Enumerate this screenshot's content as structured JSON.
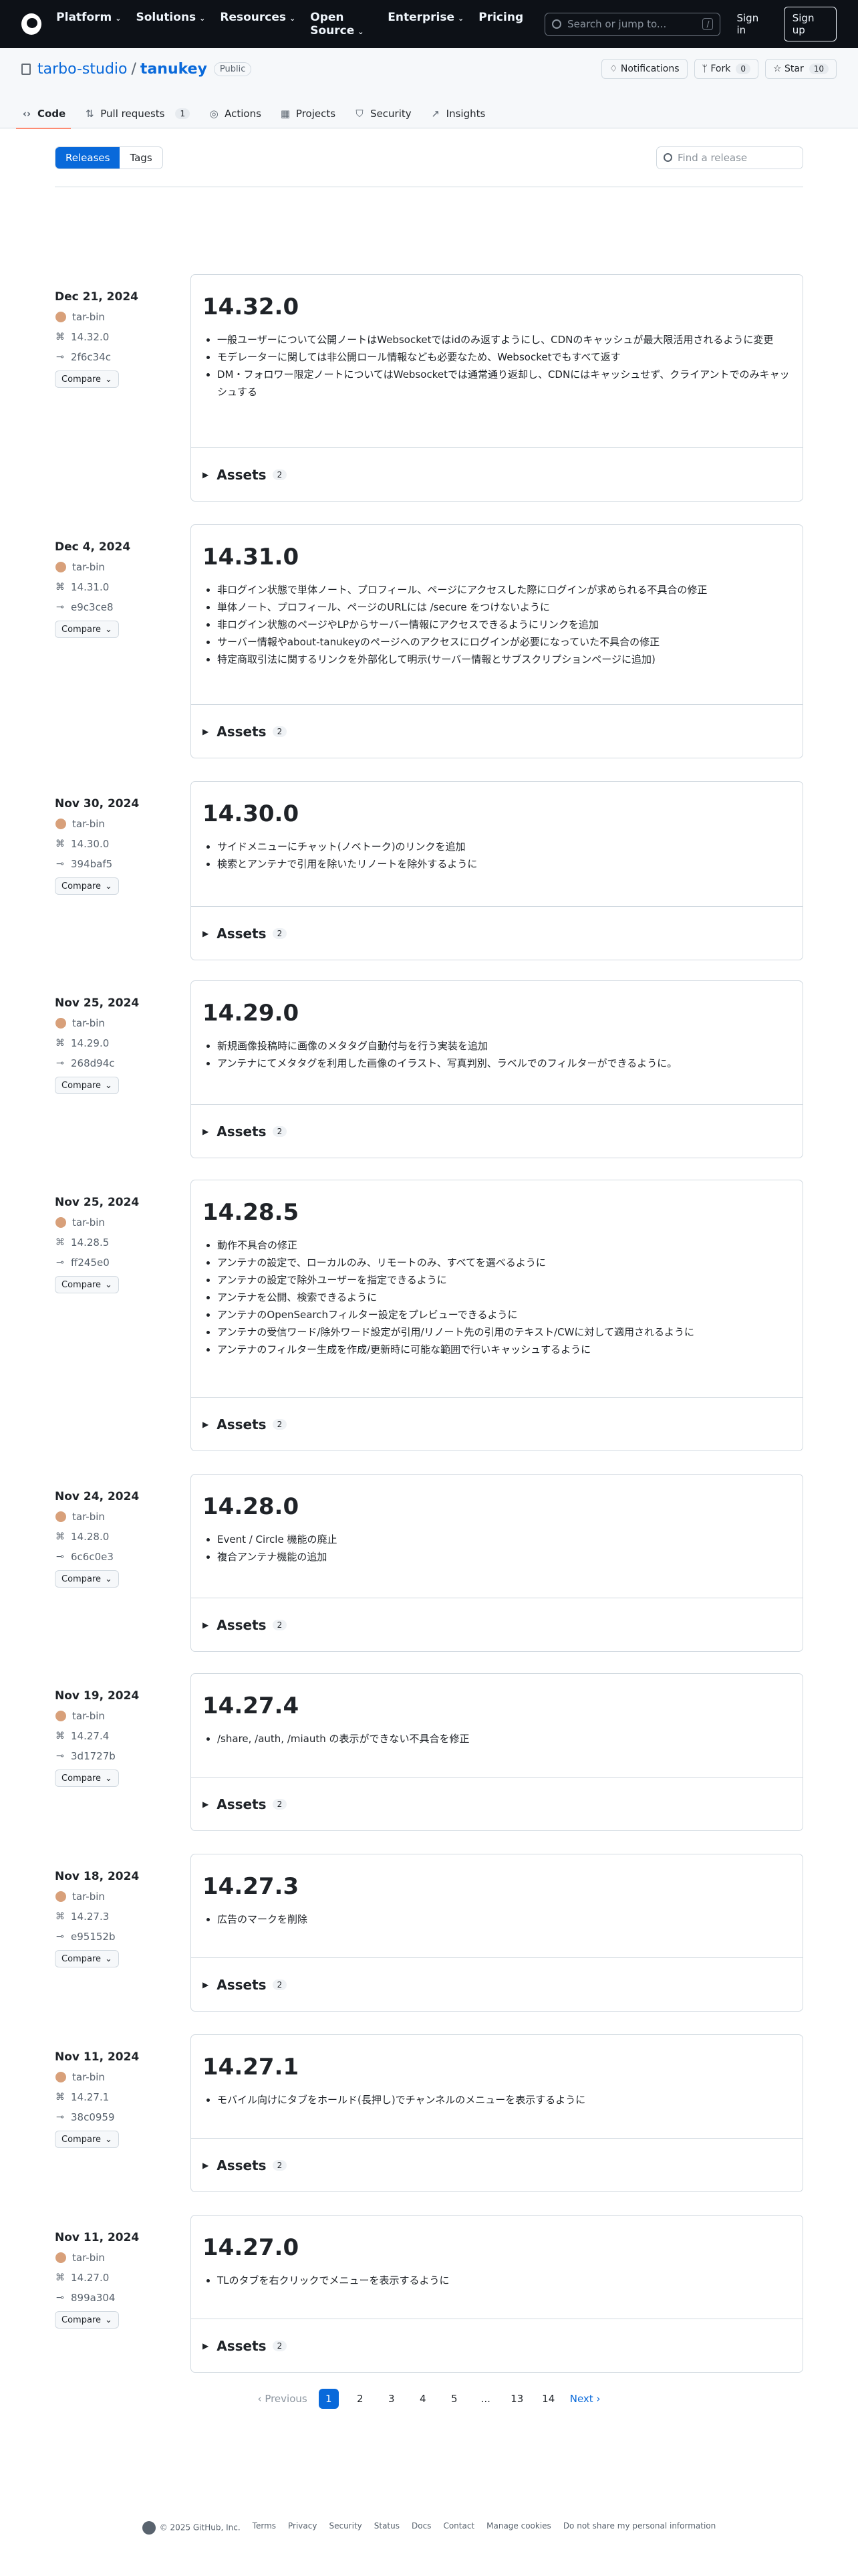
{
  "header": {
    "nav": [
      "Platform",
      "Solutions",
      "Resources",
      "Open Source",
      "Enterprise",
      "Pricing"
    ],
    "search_placeholder": "Search or jump to...",
    "slash": "/",
    "sign_in": "Sign in",
    "sign_up": "Sign up"
  },
  "repo": {
    "owner": "tarbo-studio",
    "name": "tanukey",
    "visibility": "Public",
    "notifications": "Notifications",
    "fork": "Fork",
    "fork_count": "0",
    "star": "Star",
    "star_count": "10"
  },
  "tabs": [
    {
      "label": "Code"
    },
    {
      "label": "Pull requests",
      "count": "1"
    },
    {
      "label": "Actions"
    },
    {
      "label": "Projects"
    },
    {
      "label": "Security"
    },
    {
      "label": "Insights"
    }
  ],
  "subnav": {
    "releases": "Releases",
    "tags": "Tags",
    "find_placeholder": "Find a release"
  },
  "releases": [
    {
      "date": "Dec 21, 2024",
      "author": "tar-bin",
      "tag": "14.32.0",
      "commit": "2f6c34c",
      "compare": "Compare",
      "title": "14.32.0",
      "notes": [
        "一般ユーザーについて公開ノートはWebsocketではidのみ返すようにし、CDNのキャッシュが最大限活用されるように変更",
        "モデレーターに関しては非公開ロール情報なども必要なため、Websocketでもすべて返す",
        "DM・フォロワー限定ノートについてはWebsocketでは通常通り返却し、CDNにはキャッシュせず、クライアントでのみキャッシュする"
      ],
      "assets": "Assets",
      "assets_count": "2"
    },
    {
      "date": "Dec 4, 2024",
      "author": "tar-bin",
      "tag": "14.31.0",
      "commit": "e9c3ce8",
      "compare": "Compare",
      "title": "14.31.0",
      "notes": [
        "非ログイン状態で単体ノート、プロフィール、ページにアクセスした際にログインが求められる不具合の修正",
        "単体ノート、プロフィール、ページのURLには /secure をつけないように",
        "非ログイン状態のページやLPからサーバー情報にアクセスできるようにリンクを追加",
        "サーバー情報やabout-tanukeyのページへのアクセスにログインが必要になっていた不具合の修正",
        "特定商取引法に関するリンクを外部化して明示(サーバー情報とサブスクリプションページに追加)"
      ],
      "assets": "Assets",
      "assets_count": "2"
    },
    {
      "date": "Nov 30, 2024",
      "author": "tar-bin",
      "tag": "14.30.0",
      "commit": "394baf5",
      "compare": "Compare",
      "title": "14.30.0",
      "notes": [
        "サイドメニューにチャット(ノベトーク)のリンクを追加",
        "検索とアンテナで引用を除いたリノートを除外するように"
      ],
      "assets": "Assets",
      "assets_count": "2"
    },
    {
      "date": "Nov 25, 2024",
      "author": "tar-bin",
      "tag": "14.29.0",
      "commit": "268d94c",
      "compare": "Compare",
      "title": "14.29.0",
      "notes": [
        "新規画像投稿時に画像のメタタグ自動付与を行う実装を追加",
        "アンテナにてメタタグを利用した画像のイラスト、写真判別、ラベルでのフィルターができるように。"
      ],
      "assets": "Assets",
      "assets_count": "2"
    },
    {
      "date": "Nov 25, 2024",
      "author": "tar-bin",
      "tag": "14.28.5",
      "commit": "ff245e0",
      "compare": "Compare",
      "title": "14.28.5",
      "notes": [
        "動作不具合の修正",
        "アンテナの設定で、ローカルのみ、リモートのみ、すべてを選べるように",
        "アンテナの設定で除外ユーザーを指定できるように",
        "アンテナを公開、検索できるように",
        "アンテナのOpenSearchフィルター設定をプレビューできるように",
        "アンテナの受信ワード/除外ワード設定が引用/リノート先の引用のテキスト/CWに対して適用されるように",
        "アンテナのフィルター生成を作成/更新時に可能な範囲で行いキャッシュするように"
      ],
      "assets": "Assets",
      "assets_count": "2"
    },
    {
      "date": "Nov 24, 2024",
      "author": "tar-bin",
      "tag": "14.28.0",
      "commit": "6c6c0e3",
      "compare": "Compare",
      "title": "14.28.0",
      "notes": [
        "Event / Circle 機能の廃止",
        "複合アンテナ機能の追加"
      ],
      "assets": "Assets",
      "assets_count": "2"
    },
    {
      "date": "Nov 19, 2024",
      "author": "tar-bin",
      "tag": "14.27.4",
      "commit": "3d1727b",
      "compare": "Compare",
      "title": "14.27.4",
      "notes": [
        "/share, /auth, /miauth の表示ができない不具合を修正"
      ],
      "assets": "Assets",
      "assets_count": "2"
    },
    {
      "date": "Nov 18, 2024",
      "author": "tar-bin",
      "tag": "14.27.3",
      "commit": "e95152b",
      "compare": "Compare",
      "title": "14.27.3",
      "notes": [
        "広告のマークを削除"
      ],
      "assets": "Assets",
      "assets_count": "2"
    },
    {
      "date": "Nov 11, 2024",
      "author": "tar-bin",
      "tag": "14.27.1",
      "commit": "38c0959",
      "compare": "Compare",
      "title": "14.27.1",
      "notes": [
        "モバイル向けにタブをホールド(長押し)でチャンネルのメニューを表示するように"
      ],
      "assets": "Assets",
      "assets_count": "2"
    },
    {
      "date": "Nov 11, 2024",
      "author": "tar-bin",
      "tag": "14.27.0",
      "commit": "899a304",
      "compare": "Compare",
      "title": "14.27.0",
      "notes": [
        "TLのタブを右クリックでメニューを表示するように"
      ],
      "assets": "Assets",
      "assets_count": "2"
    }
  ],
  "pagination": {
    "previous": "Previous",
    "pages": [
      "1",
      "2",
      "3",
      "4",
      "5",
      "...",
      "13",
      "14"
    ],
    "next": "Next"
  },
  "footer": {
    "copyright": "© 2025 GitHub, Inc.",
    "links": [
      "Terms",
      "Privacy",
      "Security",
      "Status",
      "Docs",
      "Contact",
      "Manage cookies",
      "Do not share my personal information"
    ]
  }
}
